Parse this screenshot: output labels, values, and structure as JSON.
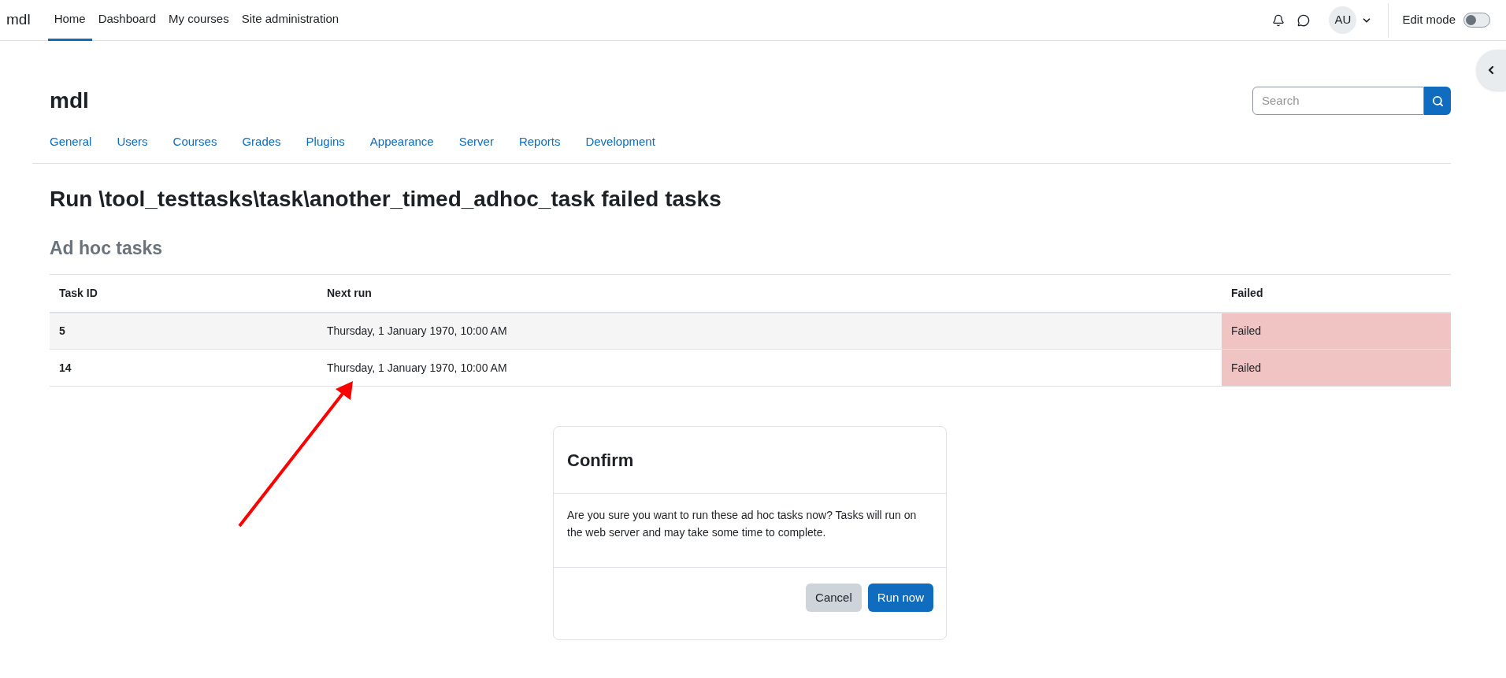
{
  "navbar": {
    "brand": "mdl",
    "items": [
      {
        "label": "Home",
        "selected": true
      },
      {
        "label": "Dashboard",
        "selected": false
      },
      {
        "label": "My courses",
        "selected": false
      },
      {
        "label": "Site administration",
        "selected": false
      }
    ],
    "avatar": "AU",
    "edit_mode": {
      "label": "Edit mode",
      "on": false
    }
  },
  "header": {
    "site_name": "mdl",
    "search": {
      "placeholder": "Search"
    }
  },
  "admin_tabs": [
    {
      "label": "General"
    },
    {
      "label": "Users"
    },
    {
      "label": "Courses"
    },
    {
      "label": "Grades"
    },
    {
      "label": "Plugins"
    },
    {
      "label": "Appearance"
    },
    {
      "label": "Server"
    },
    {
      "label": "Reports"
    },
    {
      "label": "Development"
    }
  ],
  "page_title": "Run \\tool_testtasks\\task\\another_timed_adhoc_task failed tasks",
  "section_title": "Ad hoc tasks",
  "table": {
    "columns": [
      "Task ID",
      "Next run",
      "Failed"
    ],
    "rows": [
      {
        "task_id": "5",
        "next_run": "Thursday, 1 January 1970, 10:00 AM",
        "failed_text": "Failed",
        "failed": true
      },
      {
        "task_id": "14",
        "next_run": "Thursday, 1 January 1970, 10:00 AM",
        "failed_text": "Failed",
        "failed": true
      }
    ]
  },
  "dialog": {
    "title": "Confirm",
    "message": "Are you sure you want to run these ad hoc tasks now? Tasks will run on the web server and may take some time to complete.",
    "buttons": [
      {
        "label": "Cancel",
        "kind": "secondary"
      },
      {
        "label": "Run now",
        "kind": "primary"
      }
    ]
  }
}
